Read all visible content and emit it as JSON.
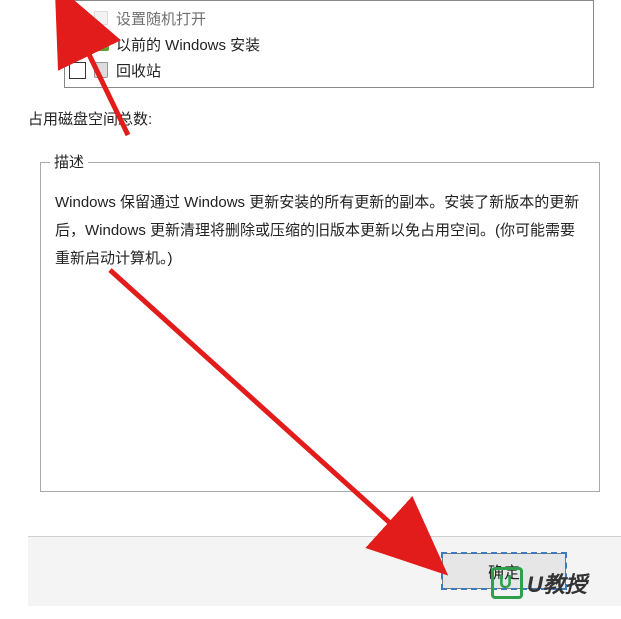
{
  "list": {
    "items": [
      {
        "checked": false,
        "label": "设置随机打开",
        "icon": "generic"
      },
      {
        "checked": true,
        "label": "以前的 Windows 安装",
        "icon": "win"
      },
      {
        "checked": false,
        "label": "回收站",
        "icon": "recycle"
      }
    ]
  },
  "total_label": "占用磁盘空间总数:",
  "description": {
    "title": "描述",
    "body": "Windows 保留通过 Windows 更新安装的所有更新的副本。安装了新版本的更新后，Windows 更新清理将删除或压缩的旧版本更新以免占用空间。(你可能需要重新启动计算机。)"
  },
  "buttons": {
    "ok": "确定"
  },
  "watermark": {
    "text": "U教授"
  },
  "annotation": {
    "color": "#e21b1b"
  }
}
